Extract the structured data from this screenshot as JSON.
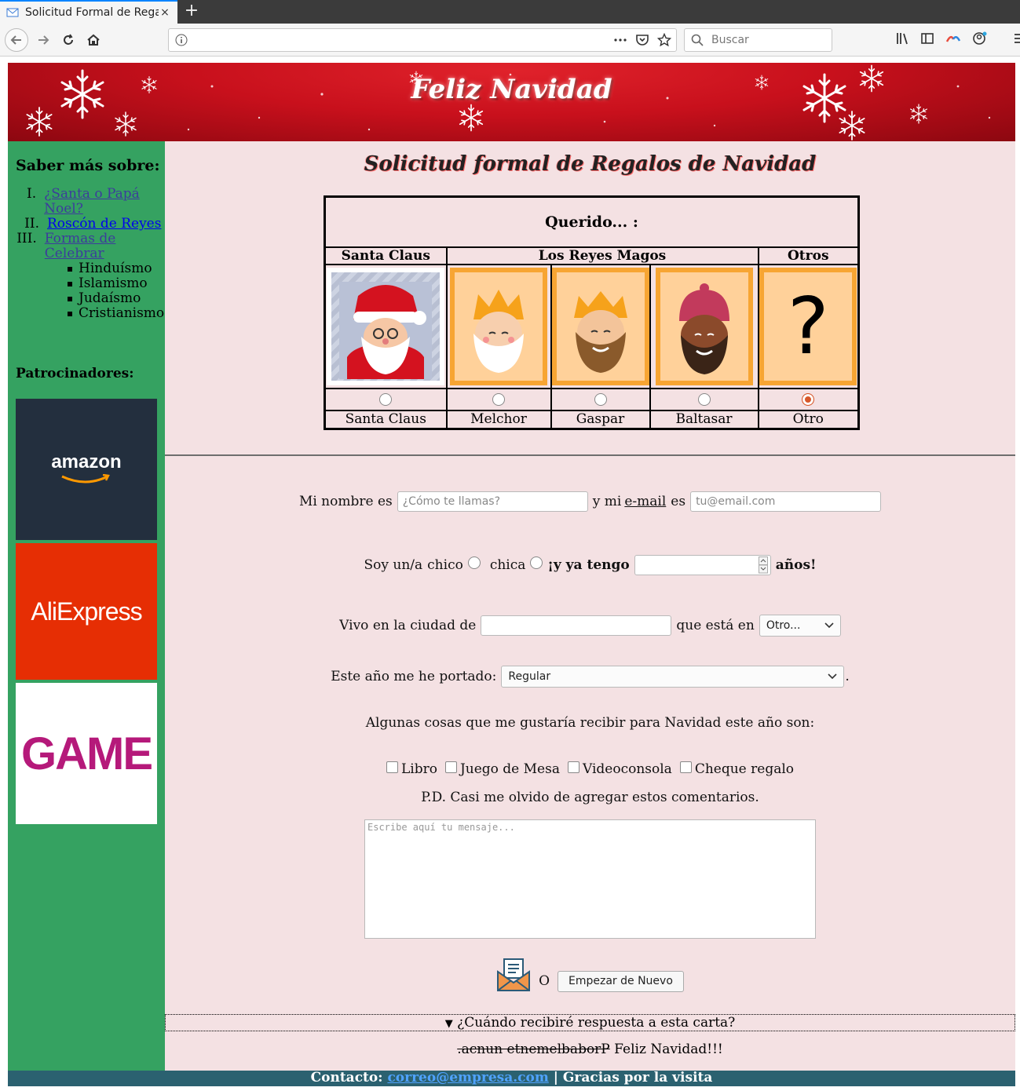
{
  "browser": {
    "tab_title": "Solicitud Formal de Regalos",
    "tab_close": "×",
    "new_tab": "+",
    "url": "",
    "search_placeholder": "Buscar"
  },
  "banner": {
    "title": "Feliz Navidad"
  },
  "sidebar": {
    "heading": "Saber más sobre:",
    "items": [
      {
        "num": "I.",
        "label": "¿Santa o Papá Noel?"
      },
      {
        "num": "II.",
        "label": "Roscón de Reyes"
      },
      {
        "num": "III.",
        "label": "Formas de Celebrar"
      }
    ],
    "subitems": [
      "Hinduísmo",
      "Islamismo",
      "Judaísmo",
      "Cristianismo"
    ],
    "sponsors_heading": "Patrocinadores:",
    "sponsors": [
      {
        "name": "amazon",
        "bg": "#232f3e",
        "color": "#ffffff"
      },
      {
        "name": "AliExpress",
        "bg": "#e62e04",
        "color": "#ffffff"
      },
      {
        "name": "GAME",
        "bg": "#ffffff",
        "color": "#b5197a"
      }
    ]
  },
  "form": {
    "title": "Solicitud formal de Regalos de Navidad",
    "table": {
      "caption": "Querido... :",
      "groups": [
        "Santa Claus",
        "Los Reyes Magos",
        "Otros"
      ],
      "options": [
        "Santa Claus",
        "Melchor",
        "Gaspar",
        "Baltasar",
        "Otro"
      ],
      "selected": "Otro",
      "question_mark": "?"
    },
    "name": {
      "label_before": "Mi nombre es",
      "placeholder": "¿Cómo te llamas?",
      "label_middle": "y mi",
      "email_word": "e-mail",
      "label_after": "es",
      "email_placeholder": "tu@email.com"
    },
    "gender": {
      "label": "Soy un/a",
      "option_boy": "chico",
      "option_girl": "chica",
      "age_label": "¡y ya tengo",
      "age_suffix": "años!"
    },
    "city": {
      "label": "Vivo en la ciudad de",
      "country_label": "que está en",
      "country_value": "Otro..."
    },
    "behaviour": {
      "label": "Este año me he portado:",
      "value": "Regular",
      "suffix": "."
    },
    "wishes": {
      "label": "Algunas cosas que me gustaría recibir para Navidad este año son:",
      "items": [
        "Libro",
        "Juego de Mesa",
        "Videoconsola",
        "Cheque regalo"
      ]
    },
    "comments": {
      "label": "P.D. Casi me olvido de agregar estos comentarios.",
      "placeholder": "Escribe aquí tu mensaje..."
    },
    "actions": {
      "or": "O",
      "reset": "Empezar de Nuevo"
    },
    "details": {
      "marker": "▼",
      "summary": "¿Cuándo recibiré respuesta a esta carta?"
    },
    "closing": {
      "struck": ".acnun etnemelbaborP",
      "text": " Feliz Navidad!!!"
    }
  },
  "footer": {
    "label": "Contacto:",
    "email": "correo@empresa.com",
    "separator": " | ",
    "thanks": "Gracias por la visita"
  }
}
